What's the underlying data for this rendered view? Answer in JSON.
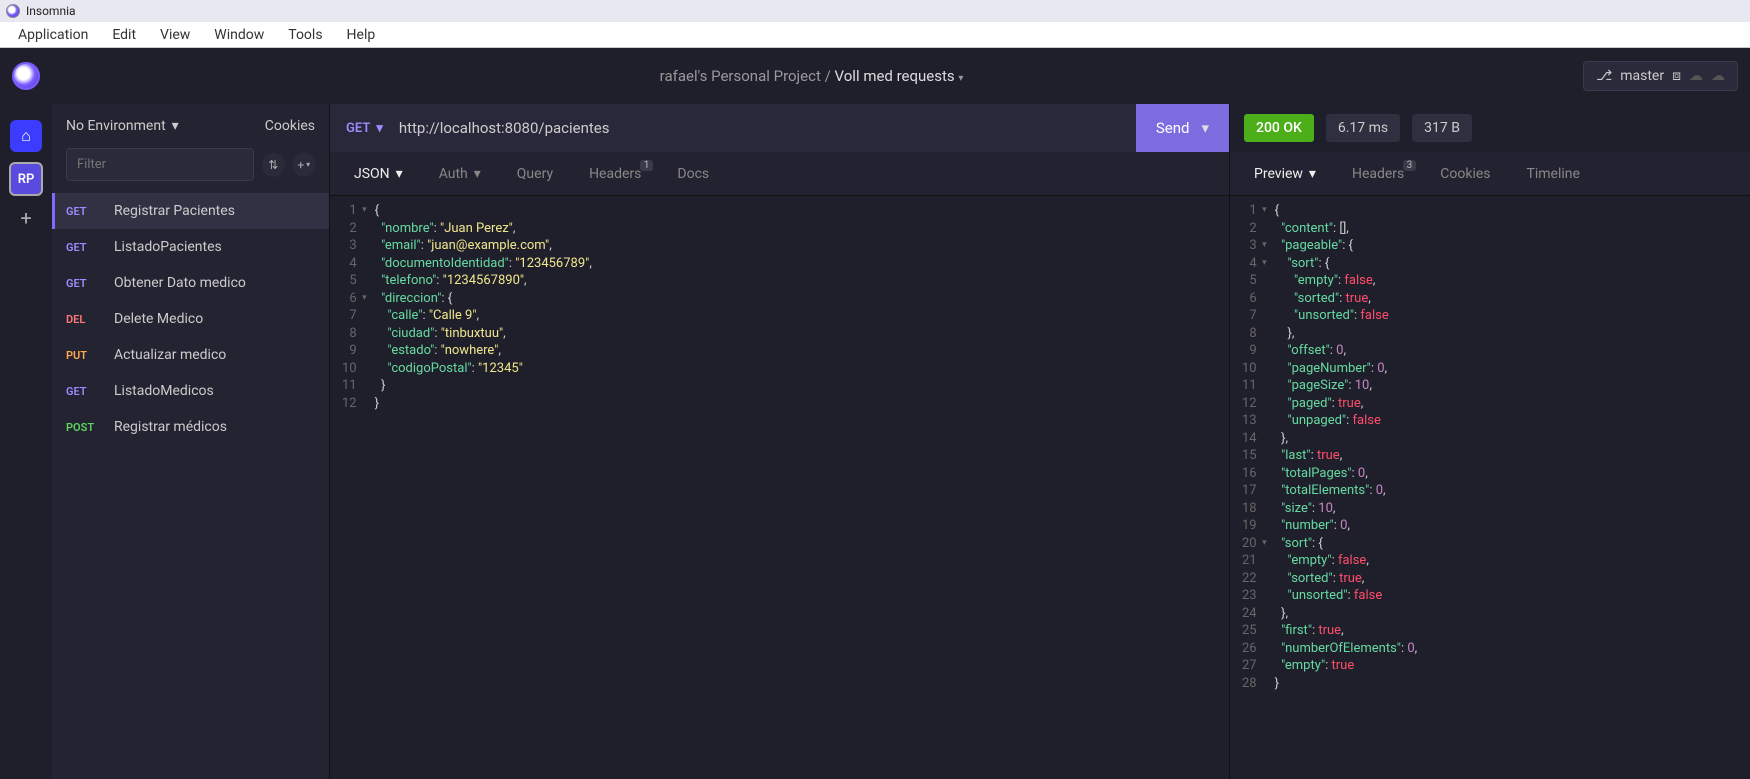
{
  "window": {
    "title": "Insomnia"
  },
  "menu": [
    "Application",
    "Edit",
    "View",
    "Window",
    "Tools",
    "Help"
  ],
  "breadcrumb": {
    "project": "rafael's Personal Project",
    "collection": "Voll med requests"
  },
  "git": {
    "branch": "master"
  },
  "environment": {
    "label": "No Environment",
    "cookies": "Cookies"
  },
  "filter": {
    "placeholder": "Filter"
  },
  "rail": {
    "project_initials": "RP"
  },
  "requests": [
    {
      "method": "GET",
      "mclass": "m-get",
      "name": "Registrar Pacientes",
      "active": true
    },
    {
      "method": "GET",
      "mclass": "m-get",
      "name": "ListadoPacientes"
    },
    {
      "method": "GET",
      "mclass": "m-get",
      "name": "Obtener Dato medico"
    },
    {
      "method": "DEL",
      "mclass": "m-del",
      "name": "Delete Medico"
    },
    {
      "method": "PUT",
      "mclass": "m-put",
      "name": "Actualizar medico"
    },
    {
      "method": "GET",
      "mclass": "m-get",
      "name": "ListadoMedicos"
    },
    {
      "method": "POST",
      "mclass": "m-post",
      "name": "Registrar médicos"
    }
  ],
  "urlbar": {
    "method": "GET",
    "url": "http://localhost:8080/pacientes",
    "send": "Send"
  },
  "req_tabs": [
    {
      "label": "JSON",
      "active": true,
      "caret": true
    },
    {
      "label": "Auth",
      "caret": true
    },
    {
      "label": "Query"
    },
    {
      "label": "Headers",
      "badge": "1"
    },
    {
      "label": "Docs"
    }
  ],
  "req_body_lines": [
    {
      "n": 1,
      "fold": true,
      "html": "<span class='p'>{</span>"
    },
    {
      "n": 2,
      "html": "  <span class='k'>\"nombre\"</span><span class='p'>: </span><span class='s'>\"Juan Perez\"</span><span class='p'>,</span>"
    },
    {
      "n": 3,
      "html": "  <span class='k'>\"email\"</span><span class='p'>: </span><span class='s'>\"juan@example.com\"</span><span class='p'>,</span>"
    },
    {
      "n": 4,
      "html": "  <span class='k'>\"documentoIdentidad\"</span><span class='p'>: </span><span class='s'>\"123456789\"</span><span class='p'>,</span>"
    },
    {
      "n": 5,
      "html": "  <span class='k'>\"telefono\"</span><span class='p'>: </span><span class='s'>\"1234567890\"</span><span class='p'>,</span>"
    },
    {
      "n": 6,
      "fold": true,
      "html": "  <span class='k'>\"direccion\"</span><span class='p'>: {</span>"
    },
    {
      "n": 7,
      "html": "    <span class='k'>\"calle\"</span><span class='p'>: </span><span class='s'>\"Calle 9\"</span><span class='p'>,</span>"
    },
    {
      "n": 8,
      "html": "    <span class='k'>\"ciudad\"</span><span class='p'>: </span><span class='s'>\"tinbuxtuu\"</span><span class='p'>,</span>"
    },
    {
      "n": 9,
      "html": "    <span class='k'>\"estado\"</span><span class='p'>: </span><span class='s'>\"nowhere\"</span><span class='p'>,</span>"
    },
    {
      "n": 10,
      "html": "    <span class='k'>\"codigoPostal\"</span><span class='p'>: </span><span class='s'>\"12345\"</span>"
    },
    {
      "n": 11,
      "html": "  <span class='p'>}</span>"
    },
    {
      "n": 12,
      "html": "<span class='p'>}</span>"
    }
  ],
  "response": {
    "status": "200 OK",
    "time": "6.17 ms",
    "size": "317 B"
  },
  "res_tabs": [
    {
      "label": "Preview",
      "active": true,
      "caret": true
    },
    {
      "label": "Headers",
      "badge": "3"
    },
    {
      "label": "Cookies"
    },
    {
      "label": "Timeline"
    }
  ],
  "res_body_lines": [
    {
      "n": 1,
      "fold": true,
      "html": "<span class='p'>{</span>"
    },
    {
      "n": 2,
      "html": "  <span class='k'>\"content\"</span><span class='p'>: [],</span>"
    },
    {
      "n": 3,
      "fold": true,
      "html": "  <span class='k'>\"pageable\"</span><span class='p'>: {</span>"
    },
    {
      "n": 4,
      "fold": true,
      "html": "    <span class='k'>\"sort\"</span><span class='p'>: {</span>"
    },
    {
      "n": 5,
      "html": "      <span class='k'>\"empty\"</span><span class='p'>: </span><span class='b'>false</span><span class='p'>,</span>"
    },
    {
      "n": 6,
      "html": "      <span class='k'>\"sorted\"</span><span class='p'>: </span><span class='b'>true</span><span class='p'>,</span>"
    },
    {
      "n": 7,
      "html": "      <span class='k'>\"unsorted\"</span><span class='p'>: </span><span class='b'>false</span>"
    },
    {
      "n": 8,
      "html": "    <span class='p'>},</span>"
    },
    {
      "n": 9,
      "html": "    <span class='k'>\"offset\"</span><span class='p'>: </span><span class='n'>0</span><span class='p'>,</span>"
    },
    {
      "n": 10,
      "html": "    <span class='k'>\"pageNumber\"</span><span class='p'>: </span><span class='n'>0</span><span class='p'>,</span>"
    },
    {
      "n": 11,
      "html": "    <span class='k'>\"pageSize\"</span><span class='p'>: </span><span class='n'>10</span><span class='p'>,</span>"
    },
    {
      "n": 12,
      "html": "    <span class='k'>\"paged\"</span><span class='p'>: </span><span class='b'>true</span><span class='p'>,</span>"
    },
    {
      "n": 13,
      "html": "    <span class='k'>\"unpaged\"</span><span class='p'>: </span><span class='b'>false</span>"
    },
    {
      "n": 14,
      "html": "  <span class='p'>},</span>"
    },
    {
      "n": 15,
      "html": "  <span class='k'>\"last\"</span><span class='p'>: </span><span class='b'>true</span><span class='p'>,</span>"
    },
    {
      "n": 16,
      "html": "  <span class='k'>\"totalPages\"</span><span class='p'>: </span><span class='n'>0</span><span class='p'>,</span>"
    },
    {
      "n": 17,
      "html": "  <span class='k'>\"totalElements\"</span><span class='p'>: </span><span class='n'>0</span><span class='p'>,</span>"
    },
    {
      "n": 18,
      "html": "  <span class='k'>\"size\"</span><span class='p'>: </span><span class='n'>10</span><span class='p'>,</span>"
    },
    {
      "n": 19,
      "html": "  <span class='k'>\"number\"</span><span class='p'>: </span><span class='n'>0</span><span class='p'>,</span>"
    },
    {
      "n": 20,
      "fold": true,
      "html": "  <span class='k'>\"sort\"</span><span class='p'>: {</span>"
    },
    {
      "n": 21,
      "html": "    <span class='k'>\"empty\"</span><span class='p'>: </span><span class='b'>false</span><span class='p'>,</span>"
    },
    {
      "n": 22,
      "html": "    <span class='k'>\"sorted\"</span><span class='p'>: </span><span class='b'>true</span><span class='p'>,</span>"
    },
    {
      "n": 23,
      "html": "    <span class='k'>\"unsorted\"</span><span class='p'>: </span><span class='b'>false</span>"
    },
    {
      "n": 24,
      "html": "  <span class='p'>},</span>"
    },
    {
      "n": 25,
      "html": "  <span class='k'>\"first\"</span><span class='p'>: </span><span class='b'>true</span><span class='p'>,</span>"
    },
    {
      "n": 26,
      "html": "  <span class='k'>\"numberOfElements\"</span><span class='p'>: </span><span class='n'>0</span><span class='p'>,</span>"
    },
    {
      "n": 27,
      "html": "  <span class='k'>\"empty\"</span><span class='p'>: </span><span class='b'>true</span>"
    },
    {
      "n": 28,
      "html": "<span class='p'>}</span>"
    }
  ]
}
